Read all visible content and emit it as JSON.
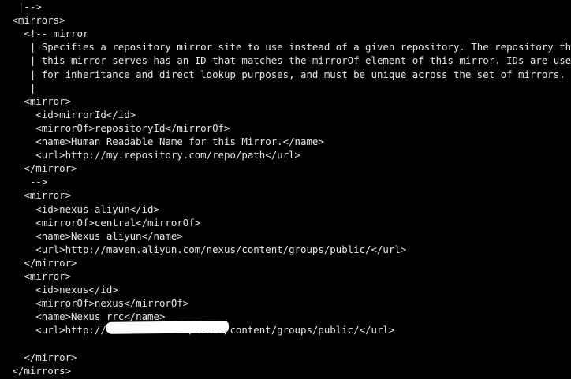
{
  "terminal": {
    "lines": [
      "  |-->",
      " <mirrors>",
      "   <!-- mirror",
      "    | Specifies a repository mirror site to use instead of a given repository. The repository that",
      "    | this mirror serves has an ID that matches the mirrorOf element of this mirror. IDs are used",
      "    | for inheritance and direct lookup purposes, and must be unique across the set of mirrors.",
      "    |",
      "   <mirror>",
      "     <id>mirrorId</id>",
      "     <mirrorOf>repositoryId</mirrorOf>",
      "     <name>Human Readable Name for this Mirror.</name>",
      "     <url>http://my.repository.com/repo/path</url>",
      "   </mirror>",
      "    -->",
      "   <mirror>",
      "     <id>nexus-aliyun</id>",
      "     <mirrorOf>central</mirrorOf>",
      "     <name>Nexus aliyun</name>",
      "     <url>http://maven.aliyun.com/nexus/content/groups/public/</url>",
      "   </mirror>",
      "   <mirror>",
      "     <id>nexus</id>",
      "     <mirrorOf>nexus</mirrorOf>",
      "     <name>Nexus rrc</name>",
      "     <url>http://              /nexus/content/groups/public/</url>",
      "",
      "   </mirror>",
      " </mirrors>"
    ]
  }
}
